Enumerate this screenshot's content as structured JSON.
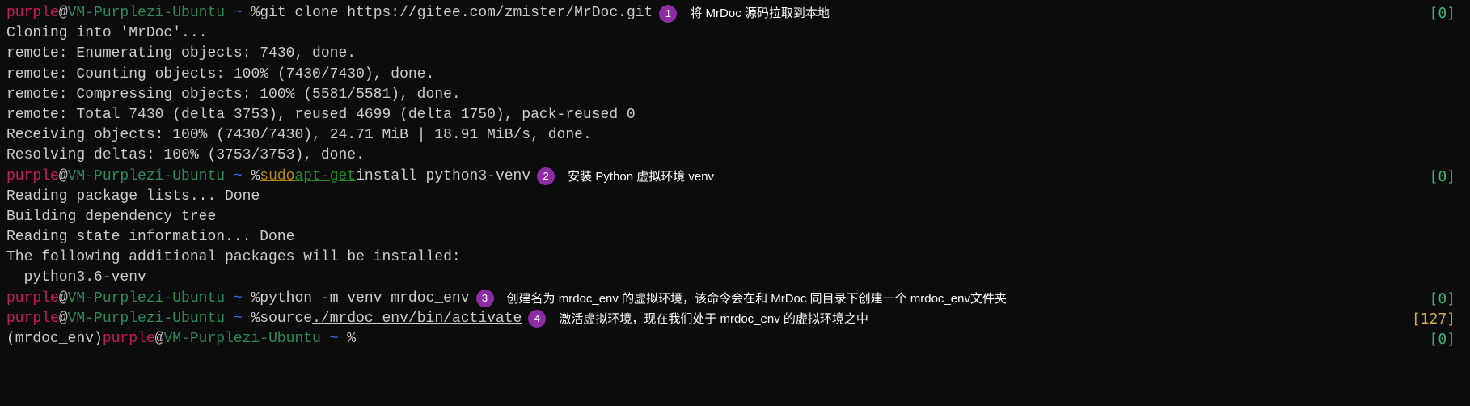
{
  "prompts": {
    "user": "purple",
    "at": "@",
    "host": "VM-Purplezi-Ubuntu",
    "path": " ~ ",
    "sym": "% "
  },
  "line1": {
    "cmd": "git clone https://gitee.com/zmister/MrDoc.git",
    "badge": "1",
    "annotation": "将 MrDoc 源码拉取到本地",
    "status": "[0]"
  },
  "out1": "Cloning into 'MrDoc'...",
  "out2": "remote: Enumerating objects: 7430, done.",
  "out3": "remote: Counting objects: 100% (7430/7430), done.",
  "out4": "remote: Compressing objects: 100% (5581/5581), done.",
  "out5": "remote: Total 7430 (delta 3753), reused 4699 (delta 1750), pack-reused 0",
  "out6": "Receiving objects: 100% (7430/7430), 24.71 MiB | 18.91 MiB/s, done.",
  "out7": "Resolving deltas: 100% (3753/3753), done.",
  "line2": {
    "sudo": "sudo",
    "apt": " apt-get",
    "rest": " install python3-venv",
    "badge": "2",
    "annotation": "安装 Python 虚拟环境 venv",
    "status": "[0]"
  },
  "out8": "Reading package lists... Done",
  "out9": "Building dependency tree",
  "out10": "Reading state information... Done",
  "out11": "The following additional packages will be installed:",
  "out12": "  python3.6-venv",
  "line3": {
    "cmd": "python -m venv mrdoc_env",
    "badge": "3",
    "annotation": "创建名为 mrdoc_env 的虚拟环境，该命令会在和 MrDoc 同目录下创建一个 mrdoc_env文件夹",
    "status": "[0]"
  },
  "line4": {
    "cmd1": "source ",
    "path": "./mrdoc_env/bin/activate",
    "badge": "4",
    "annotation": "激活虚拟环境，现在我们处于 mrdoc_env 的虚拟环境之中",
    "status": "[127]"
  },
  "line5": {
    "prefix": "(mrdoc_env) ",
    "status": "[0]"
  }
}
